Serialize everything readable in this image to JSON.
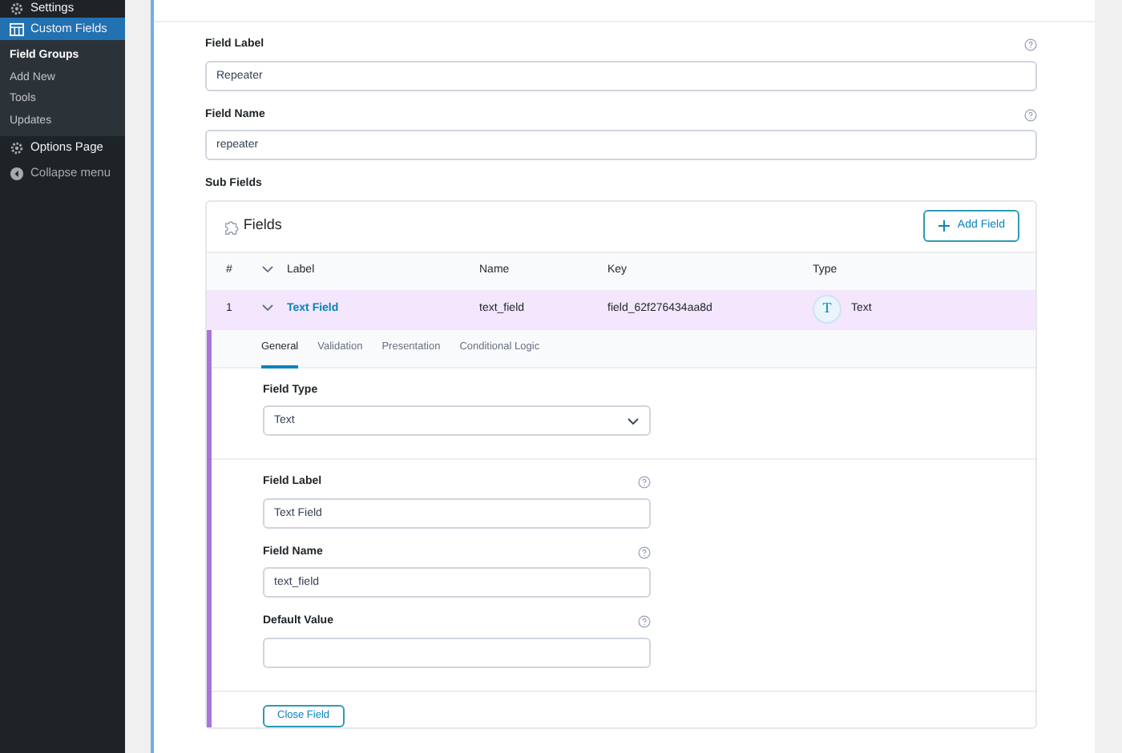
{
  "sidebar": {
    "items": [
      {
        "label": "Settings",
        "kind": "menu",
        "selected": false
      },
      {
        "label": "Custom Fields",
        "kind": "menu",
        "selected": true
      },
      {
        "label": "Field Groups",
        "kind": "sub",
        "selected": true
      },
      {
        "label": "Add New",
        "kind": "sub",
        "selected": false
      },
      {
        "label": "Tools",
        "kind": "sub",
        "selected": false
      },
      {
        "label": "Updates",
        "kind": "sub",
        "selected": false
      },
      {
        "label": "Options Page",
        "kind": "menu",
        "selected": false
      },
      {
        "label": "Collapse menu",
        "kind": "collapse",
        "selected": false
      }
    ]
  },
  "fields": [
    {
      "label": "Field Label",
      "value": "Repeater"
    },
    {
      "label": "Field Name",
      "value": "repeater"
    }
  ],
  "sub_fields": {
    "label": "Sub Fields",
    "title": "Fields",
    "add_button": "Add Field",
    "columns": [
      "#",
      "Label",
      "Name",
      "Key",
      "Type"
    ],
    "rows": [
      {
        "number": "1",
        "label": "Text Field",
        "name": "text_field",
        "key": "field_62f276434aa8d",
        "type_icon": "T",
        "type": "Text",
        "expanded": true
      }
    ],
    "tabs": [
      {
        "label": "General",
        "selected": true
      },
      {
        "label": "Validation",
        "selected": false
      },
      {
        "label": "Presentation",
        "selected": false
      },
      {
        "label": "Conditional Logic",
        "selected": false
      }
    ],
    "field_type": {
      "label": "Field Type",
      "value": "Text"
    },
    "settings": [
      {
        "label": "Field Label",
        "value": "Text Field"
      },
      {
        "label": "Field Name",
        "value": "text_field"
      },
      {
        "label": "Default Value"
      }
    ],
    "close_button": "Close Field"
  }
}
